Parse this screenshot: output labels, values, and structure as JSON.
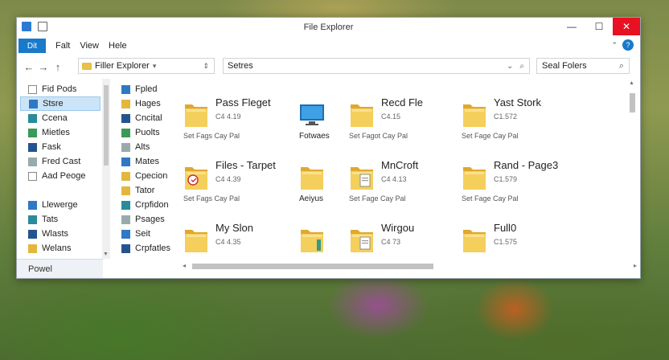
{
  "window": {
    "title": "File Explorer",
    "minimize": "—",
    "maximize": "☐",
    "close": "✕"
  },
  "menubar": {
    "file": "Dit",
    "items": [
      "Falt",
      "View",
      "Hele"
    ],
    "chevron": "⌃",
    "help": "?"
  },
  "address": {
    "back": "←",
    "forward": "→",
    "up": "↑",
    "path": "Filler Explorer",
    "dropdown": "▾",
    "sort": "⇕",
    "search_value": "Setres",
    "search_dropdown": "⌄",
    "search_icon": "⌕",
    "side_search_placeholder": "Seal Folers",
    "side_search_icon": "⌕"
  },
  "nav_primary": [
    {
      "label": "Fid Pods",
      "icon": "document-icon",
      "color": "doc"
    },
    {
      "label": "Stsre",
      "icon": "monitor-icon",
      "color": "blue",
      "selected": true
    },
    {
      "label": "Ccena",
      "icon": "globe-icon",
      "color": "teal"
    },
    {
      "label": "Mietles",
      "icon": "image-icon",
      "color": "green"
    },
    {
      "label": "Fask",
      "icon": "flag-icon",
      "color": "navy"
    },
    {
      "label": "Fred Cast",
      "icon": "file-icon",
      "color": "gray"
    },
    {
      "label": "Aad Peoge",
      "icon": "document-icon",
      "color": "doc"
    },
    {
      "label": "Llewerge",
      "icon": "drive-icon",
      "color": "blue",
      "gap": true
    },
    {
      "label": "Tats",
      "icon": "picture-icon",
      "color": "teal"
    },
    {
      "label": "Wlasts",
      "icon": "network-icon",
      "color": "navy"
    },
    {
      "label": "Welans",
      "icon": "folder-icon",
      "color": "yellow"
    }
  ],
  "nav_primary_footer": "Powel",
  "nav_secondary": [
    {
      "label": "Fpled",
      "icon": "pin-icon",
      "color": "blue"
    },
    {
      "label": "Hages",
      "icon": "folder-icon",
      "color": "yellow"
    },
    {
      "label": "Cncital",
      "icon": "file-icon",
      "color": "navy"
    },
    {
      "label": "Puolts",
      "icon": "image-icon",
      "color": "green"
    },
    {
      "label": "Alts",
      "icon": "pen-icon",
      "color": "gray"
    },
    {
      "label": "Mates",
      "icon": "monitor-icon",
      "color": "blue"
    },
    {
      "label": "Cpecion",
      "icon": "folder-icon",
      "color": "yellow"
    },
    {
      "label": "Tator",
      "icon": "folder-icon",
      "color": "yellow"
    },
    {
      "label": "Crpfidon",
      "icon": "monitor-icon",
      "color": "teal"
    },
    {
      "label": "Psages",
      "icon": "search-icon",
      "color": "gray"
    },
    {
      "label": "Seit",
      "icon": "settings-icon",
      "color": "blue"
    },
    {
      "label": "Crpfatles",
      "icon": "folder-icon",
      "color": "navy"
    }
  ],
  "tiles": [
    {
      "name": "Pass Fleget",
      "sub": "C4 4.19",
      "meta": "Set Fags  Cay Pal",
      "overlay": ""
    },
    {
      "name": "",
      "sub": "",
      "meta": "Fotwaes",
      "overlay": "monitor"
    },
    {
      "name": "Recd Fle",
      "sub": "C4.15",
      "meta": "Set Fagot  Cay Pal",
      "overlay": ""
    },
    {
      "name": "Yast Stork",
      "sub": "C1.572",
      "meta": "Set Fage  Cay Pal",
      "overlay": ""
    },
    {
      "name": "Files - Tarpet",
      "sub": "C4 4.39",
      "meta": "Set Fags  Cay Pal",
      "overlay": "shield"
    },
    {
      "name": "",
      "sub": "",
      "meta": "Aeiyus",
      "overlay": ""
    },
    {
      "name": "MnCroft",
      "sub": "C4 4.13",
      "meta": "Set Fage  Cay Pal",
      "overlay": "doc"
    },
    {
      "name": "Rand - Page3",
      "sub": "C1.579",
      "meta": "Set Fage  Cay Pal",
      "overlay": ""
    },
    {
      "name": "My Slon",
      "sub": "C4 4.35",
      "meta": "",
      "overlay": ""
    },
    {
      "name": "",
      "sub": "",
      "meta": "",
      "overlay": "bottle"
    },
    {
      "name": "Wirgou",
      "sub": "C4 73",
      "meta": "",
      "overlay": "doc"
    },
    {
      "name": "Full0",
      "sub": "C1.575",
      "meta": "",
      "overlay": ""
    }
  ],
  "scroll": {
    "up": "▲",
    "down": "▼",
    "left": "◂",
    "right": "▸"
  },
  "colors": {
    "accent": "#1979ca",
    "selection": "#cce4f7",
    "folder": "#f1c84e",
    "close": "#e81123"
  }
}
